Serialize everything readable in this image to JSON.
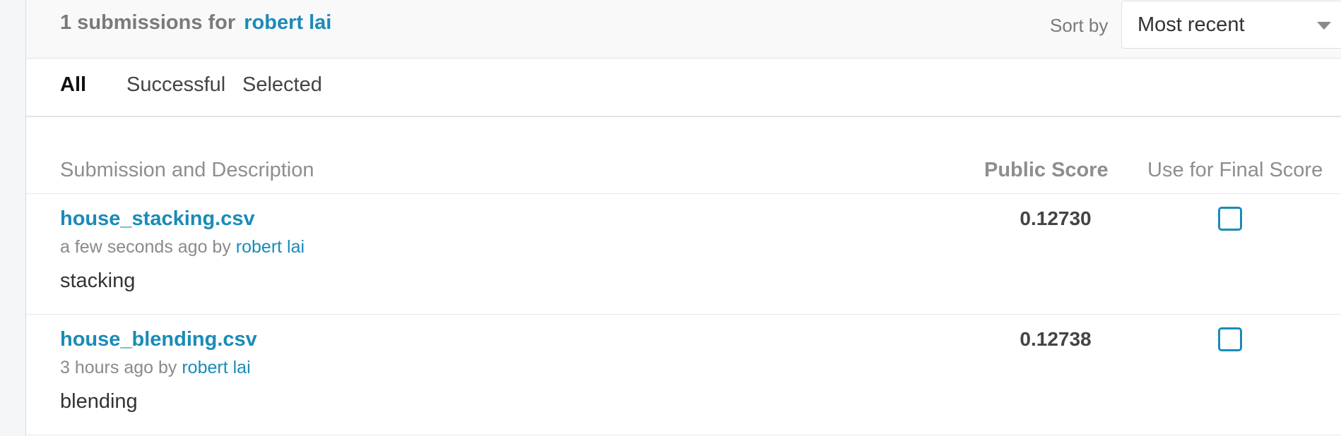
{
  "header": {
    "count_text": "1 submissions for",
    "user_name": "robert lai",
    "sort_label": "Sort by",
    "sort_value": "Most recent"
  },
  "tabs": [
    {
      "label": "All",
      "active": true
    },
    {
      "label": "Successful",
      "active": false
    },
    {
      "label": "Selected",
      "active": false
    }
  ],
  "table": {
    "columns": [
      "Submission and Description",
      "Public Score",
      "Use for Final Score"
    ],
    "rows": [
      {
        "file": "house_stacking.csv",
        "time": "a few seconds ago by",
        "user": "robert lai",
        "description": "stacking",
        "public_score": "0.12730",
        "selected": false
      },
      {
        "file": "house_blending.csv",
        "time": "3 hours ago by",
        "user": "robert lai",
        "description": "blending",
        "public_score": "0.12738",
        "selected": false
      }
    ]
  },
  "colors": {
    "link": "#1a8bb8",
    "muted": "#8a8a8a",
    "text": "#333333"
  }
}
